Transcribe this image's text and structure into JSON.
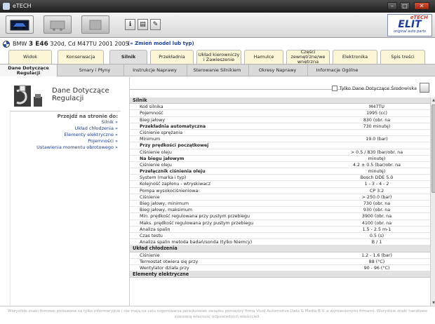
{
  "window": {
    "title": "eTECH"
  },
  "logo": {
    "brand": "eTECH",
    "name": "ELIT",
    "tagline": "original auto parts"
  },
  "vehicle": {
    "make": "BMW",
    "model": "3 E46",
    "details": "320d, Cd M47TU 2001 2005",
    "change_link": "(« Zmień model lub typ)"
  },
  "tabs": [
    {
      "label": "Widok"
    },
    {
      "label": "Konserwacja"
    },
    {
      "label": "Silnik"
    },
    {
      "label": "Przekładnia"
    },
    {
      "label": "Układ kierowniczy i Zawieszenie"
    },
    {
      "label": "Hamulce"
    },
    {
      "label": "Części zewnętrzne/we wnętrzna"
    },
    {
      "label": "Elektronika"
    },
    {
      "label": "Spis treści"
    }
  ],
  "subtabs": [
    {
      "label": "Dane Dotyczące Regulacji"
    },
    {
      "label": "Smary i Płyny"
    },
    {
      "label": "Instrukcje Naprawy"
    },
    {
      "label": "Sterowanie Silnikiem"
    },
    {
      "label": "Okresy Naprawy"
    },
    {
      "label": "Informacje Ogólne"
    }
  ],
  "left": {
    "title_line1": "Dane Dotyczące",
    "title_line2": "Regulacji",
    "goto_title": "Przejdź na stronie do:",
    "links": [
      "Silnik »",
      "Układ chłodzenia »",
      "Elementy elektryczne »",
      "Pojemności »",
      "Ustawienia momentu obrotowego »"
    ]
  },
  "right": {
    "checkbox_label": "Tylko Dane Dotyczące Środowiska"
  },
  "table": [
    {
      "type": "header",
      "label": "Silnik"
    },
    {
      "label": "Kod silnika",
      "value": "M47TU"
    },
    {
      "label": "Pojemność",
      "value": "1995 (cc)"
    },
    {
      "label": "Bieg jałowy",
      "value": "830 (obr. na"
    },
    {
      "label": "Przekładnia automatyczna",
      "value": "730 minutę)",
      "bold": true
    },
    {
      "label": "Ciśnienie sprężania",
      "value": ""
    },
    {
      "label": "Minimum",
      "value": "19.0 (bar)"
    },
    {
      "label": "Przy prędkości początkowej",
      "value": "",
      "bold": true
    },
    {
      "label": "Ciśnienie oleju",
      "value": "> 0.5 / 830 (bar/obr. na"
    },
    {
      "label": "Na biegu jałowym",
      "value": "minutę)",
      "bold": true
    },
    {
      "label": "Ciśnienie oleju",
      "value": "4.2 ± 0.5 (bar/obr. na"
    },
    {
      "label": "Przełącznik ciśnienia oleju",
      "value": "minutę)",
      "bold": true
    },
    {
      "label": "System (marka i typ)",
      "value": "Bosch DDE 5.0"
    },
    {
      "label": "Kolejność zapłonu - wtryskiwacz",
      "value": "1 - 3 - 4 - 2"
    },
    {
      "label": "Pompa wysokociśnieniowa:",
      "value": "CP 3.2"
    },
    {
      "label": "Ciśnienie",
      "value": "> 250.0 (bar)"
    },
    {
      "label": "Bieg jałowy, minimum",
      "value": "730 (obr. na"
    },
    {
      "label": "Bieg jałowy, maksimum",
      "value": "930 (obr. na"
    },
    {
      "label": "Min. prędkość regulowana przy pustym przebiegu",
      "value": "3900 (obr. na"
    },
    {
      "label": "Maks. prędkość regulowana przy pustym przebiegu",
      "value": "4100 (obr. na"
    },
    {
      "label": "Analiza spalin",
      "value": "1.5 - 2.5 m-1"
    },
    {
      "label": "Czas testu",
      "value": "0.5 (s)"
    },
    {
      "label": "Analiza spalin metoda badań/sonda (tylko Niemcy)",
      "value": "B / 1"
    },
    {
      "type": "header",
      "label": "Układ chłodzenia"
    },
    {
      "label": "Ciśnienie",
      "value": "1.2 - 1.6 (bar)"
    },
    {
      "label": "Termostat otwiera się przy",
      "value": "88 (°C)"
    },
    {
      "label": "Wentylator działa przy",
      "value": "90 - 96 (°C)"
    },
    {
      "type": "header",
      "label": "Elementy elektryczne"
    }
  ],
  "footer": {
    "text": "Wszystkie znaki firmowe podawane są tylko informacyjnie i nie mają na celu sugerowania jakiejkolwiek związku pomiędzy firmą Vivid Automotive Data & Media B.V. a wymienionymi firmami. Wszystkie znaki handlowe stanowią własność odpowiednich właścicieli."
  }
}
